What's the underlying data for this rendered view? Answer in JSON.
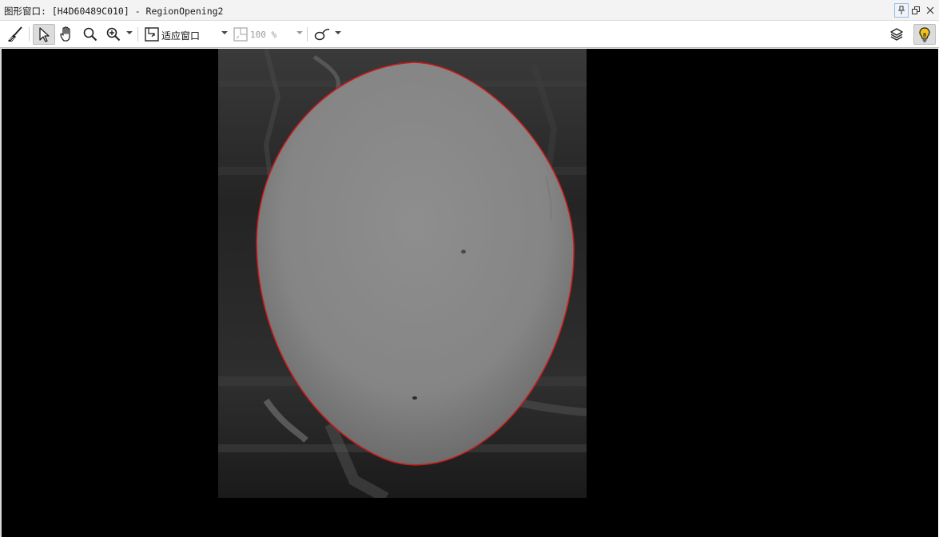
{
  "window": {
    "title": "图形窗口: [H4D60489C010] - RegionOpening2"
  },
  "title_buttons": [
    {
      "name": "pin",
      "icon": "pin-icon"
    },
    {
      "name": "restore",
      "icon": "restore-icon"
    },
    {
      "name": "close",
      "icon": "close-icon"
    }
  ],
  "toolbar": {
    "fit_label": "适应窗口",
    "zoom_value": "100 %",
    "tools": [
      {
        "name": "clear",
        "icon": "broom-icon"
      },
      {
        "name": "select",
        "icon": "arrow-pointer-icon",
        "active": true
      },
      {
        "name": "pan",
        "icon": "hand-icon"
      },
      {
        "name": "magnify",
        "icon": "magnifier-icon"
      },
      {
        "name": "zoom",
        "icon": "zoom-in-icon"
      },
      {
        "name": "fit",
        "icon": "fit-window-icon"
      },
      {
        "name": "zoom-percent",
        "icon": "zoom-percent-icon"
      },
      {
        "name": "draw-region",
        "icon": "draw-region-icon"
      },
      {
        "name": "layers",
        "icon": "layers-icon"
      },
      {
        "name": "hint",
        "icon": "lightbulb-icon",
        "active": true
      }
    ]
  },
  "colors": {
    "region_outline": "#d01818",
    "canvas_background": "#000000",
    "bulb": "#f2c21b"
  }
}
